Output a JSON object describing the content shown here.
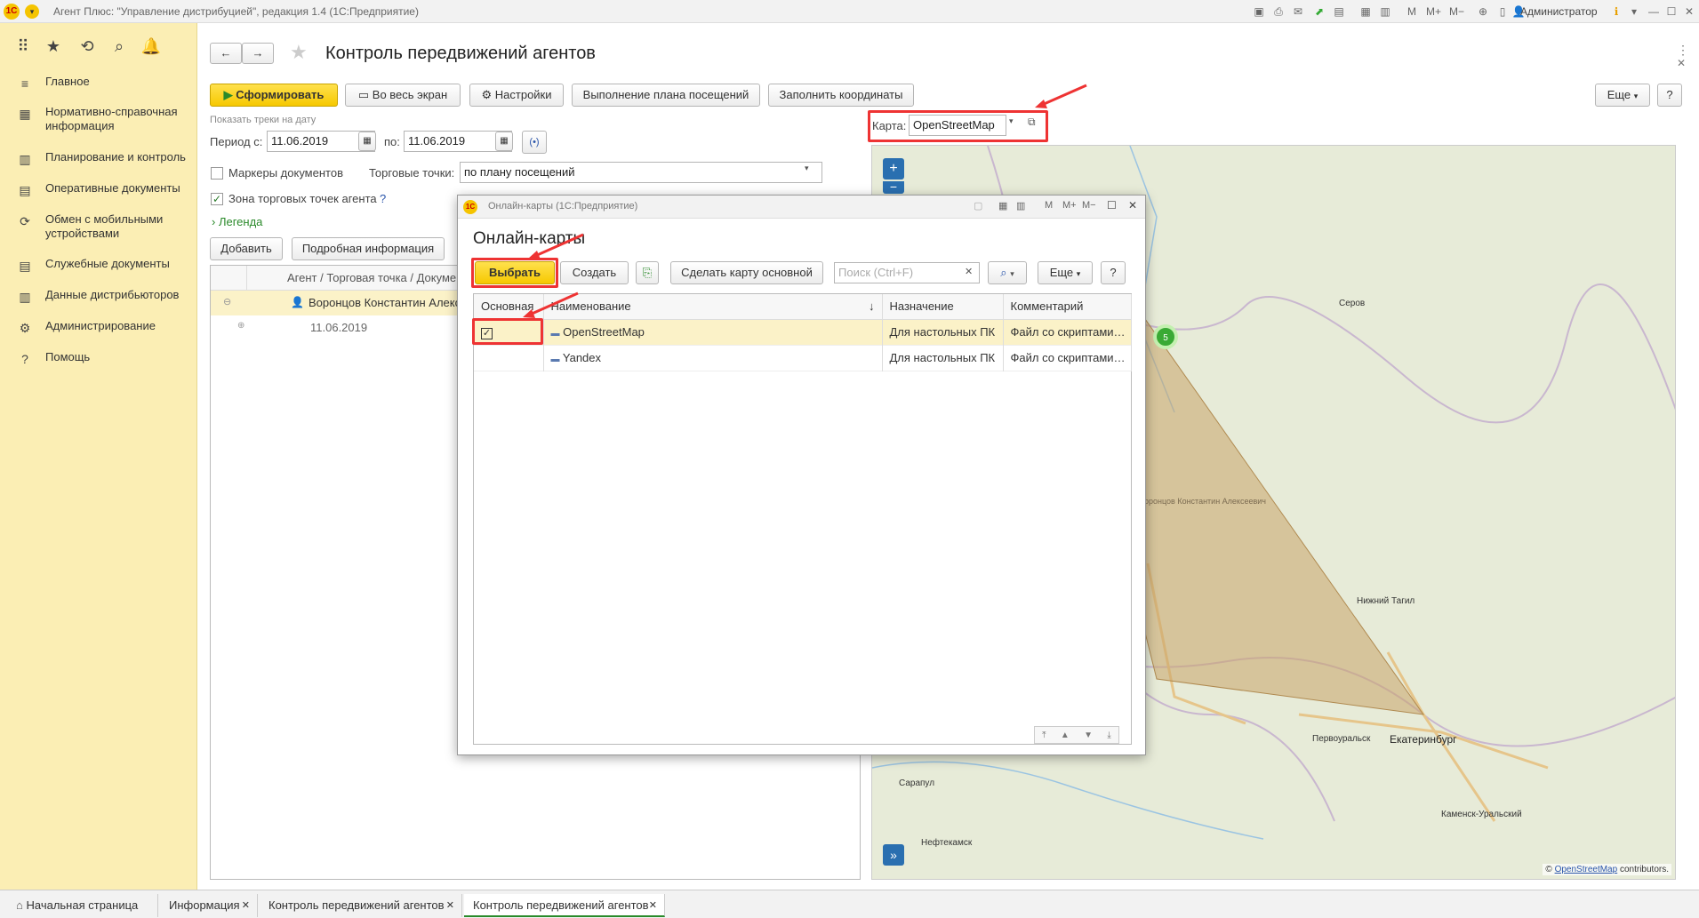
{
  "window": {
    "title": "Агент Плюс: \"Управление дистрибуцией\", редакция 1.4  (1С:Предприятие)",
    "user": "Администратор"
  },
  "nav": {
    "items": [
      {
        "label": "Главное",
        "icon": "menu-icon"
      },
      {
        "label": "Нормативно-справочная информация",
        "icon": "grid-icon"
      },
      {
        "label": "Планирование и контроль",
        "icon": "chart-icon"
      },
      {
        "label": "Оперативные документы",
        "icon": "document-icon"
      },
      {
        "label": "Обмен с мобильными устройствами",
        "icon": "sync-icon"
      },
      {
        "label": "Служебные документы",
        "icon": "document-icon"
      },
      {
        "label": "Данные дистрибьюторов",
        "icon": "chart-icon"
      },
      {
        "label": "Администрирование",
        "icon": "gear-icon"
      },
      {
        "label": "Помощь",
        "icon": "help-icon"
      }
    ]
  },
  "page": {
    "title": "Контроль передвижений агентов",
    "toolbar": {
      "generate": "Сформировать",
      "fullscreen": "Во весь экран",
      "settings": "Настройки",
      "plan": "Выполнение плана посещений",
      "fill_coords": "Заполнить координаты",
      "more": "Еще"
    },
    "filters": {
      "tracks_label": "Показать треки на дату",
      "period_from_label": "Период с:",
      "period_from": "11.06.2019",
      "period_to_label": "по:",
      "period_to": "11.06.2019",
      "doc_markers": "Маркеры документов",
      "trade_points_label": "Торговые точки:",
      "trade_points_value": "по плану посещений",
      "zone": "Зона торговых точек агента",
      "legend": "Легенда"
    },
    "list": {
      "add": "Добавить",
      "details": "Подробная информация",
      "column": "Агент / Торговая точка / Документ",
      "rows": [
        {
          "text": "Воронцов Константин Алексеевич"
        },
        {
          "text": "11.06.2019"
        }
      ]
    },
    "map": {
      "label": "Карта:",
      "value": "OpenStreetMap",
      "cluster_count": "5",
      "attribution_pre": "©",
      "attribution_link": "OpenStreetMap",
      "attribution_post": "contributors.",
      "places": {
        "serov": "Серов",
        "tagil": "Нижний Тагил",
        "pervouralsk": "Первоуральск",
        "ekb": "Екатеринбург",
        "sarapul": "Сарапул",
        "kamensk": "Каменск-Уральский",
        "neftekamsk": "Нефтекамск",
        "agent": "Воронцов Константин Алексеевич"
      }
    }
  },
  "dialog": {
    "window_title": "Онлайн-карты  (1С:Предприятие)",
    "heading": "Онлайн-карты",
    "select": "Выбрать",
    "create": "Создать",
    "make_default": "Сделать карту основной",
    "search_placeholder": "Поиск (Ctrl+F)",
    "more": "Еще",
    "help": "?",
    "columns": {
      "main": "Основная",
      "name": "Наименование",
      "purpose": "Назначение",
      "comment": "Комментарий"
    },
    "rows": [
      {
        "main": true,
        "name": "OpenStreetMap",
        "purpose": "Для настольных ПК",
        "comment": "Файл со скриптами…"
      },
      {
        "main": false,
        "name": "Yandex",
        "purpose": "Для настольных ПК",
        "comment": "Файл со скриптами…"
      }
    ]
  },
  "tabs": [
    {
      "label": "Начальная страница"
    },
    {
      "label": "Информация"
    },
    {
      "label": "Контроль передвижений агентов"
    },
    {
      "label": "Контроль передвижений агентов"
    }
  ],
  "colors": {
    "accent": "#f6c800",
    "highlight": "#e33333",
    "nav_bg": "#fbeeb4"
  }
}
